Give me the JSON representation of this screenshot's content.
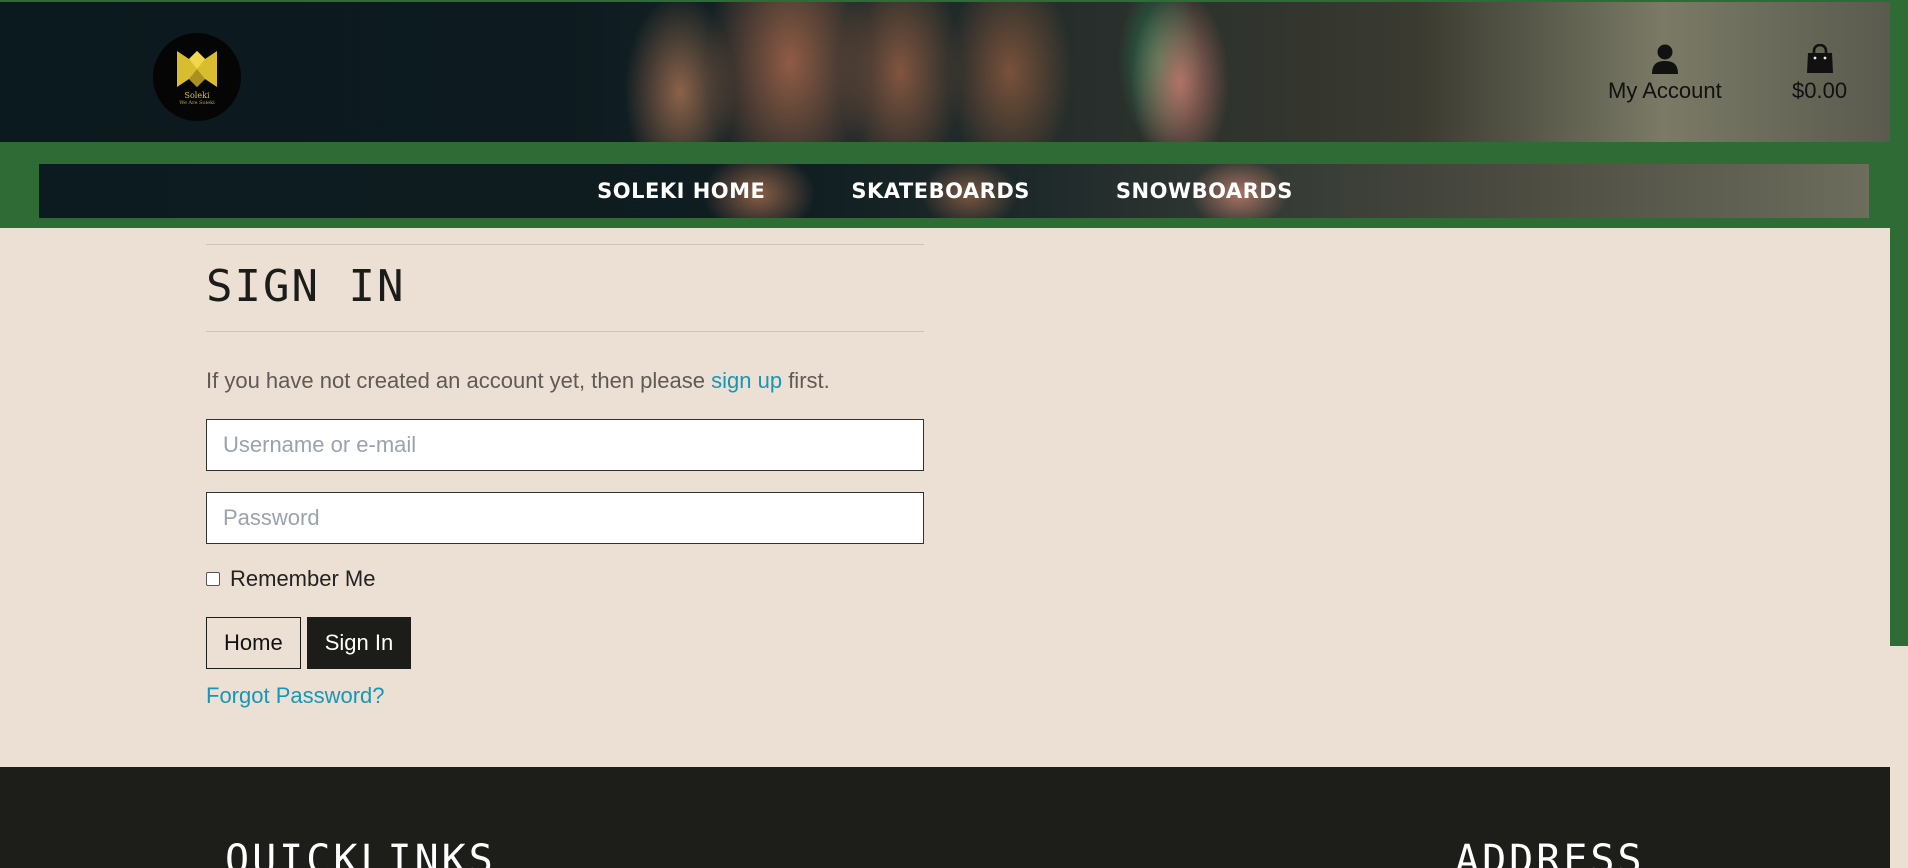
{
  "header": {
    "logo": {
      "name": "Soleki",
      "tagline": "We Are Soleki"
    },
    "account_label": "My Account",
    "bag_total": "$0.00",
    "icons": {
      "account": "user-icon",
      "bag": "shopping-bag-icon"
    }
  },
  "nav": {
    "items": [
      {
        "label": "SOLEKI HOME"
      },
      {
        "label": "SKATEBOARDS"
      },
      {
        "label": "SNOWBOARDS"
      }
    ]
  },
  "signin": {
    "title": "SIGN IN",
    "intro_before": "If you have not created an account yet, then please ",
    "signup_link": "sign up",
    "intro_after": " first.",
    "username_placeholder": "Username or e-mail",
    "password_placeholder": "Password",
    "remember_label": "Remember Me",
    "remember_checked": false,
    "home_button": "Home",
    "signin_button": "Sign In",
    "forgot_link": "Forgot Password?"
  },
  "footer": {
    "quicklinks_heading": "QUICKLINKS",
    "address_heading": "ADDRESS"
  },
  "colors": {
    "brand_green": "#2f6b34",
    "background": "#ece0d5",
    "dark": "#1c1c18",
    "link": "#1597b5"
  }
}
